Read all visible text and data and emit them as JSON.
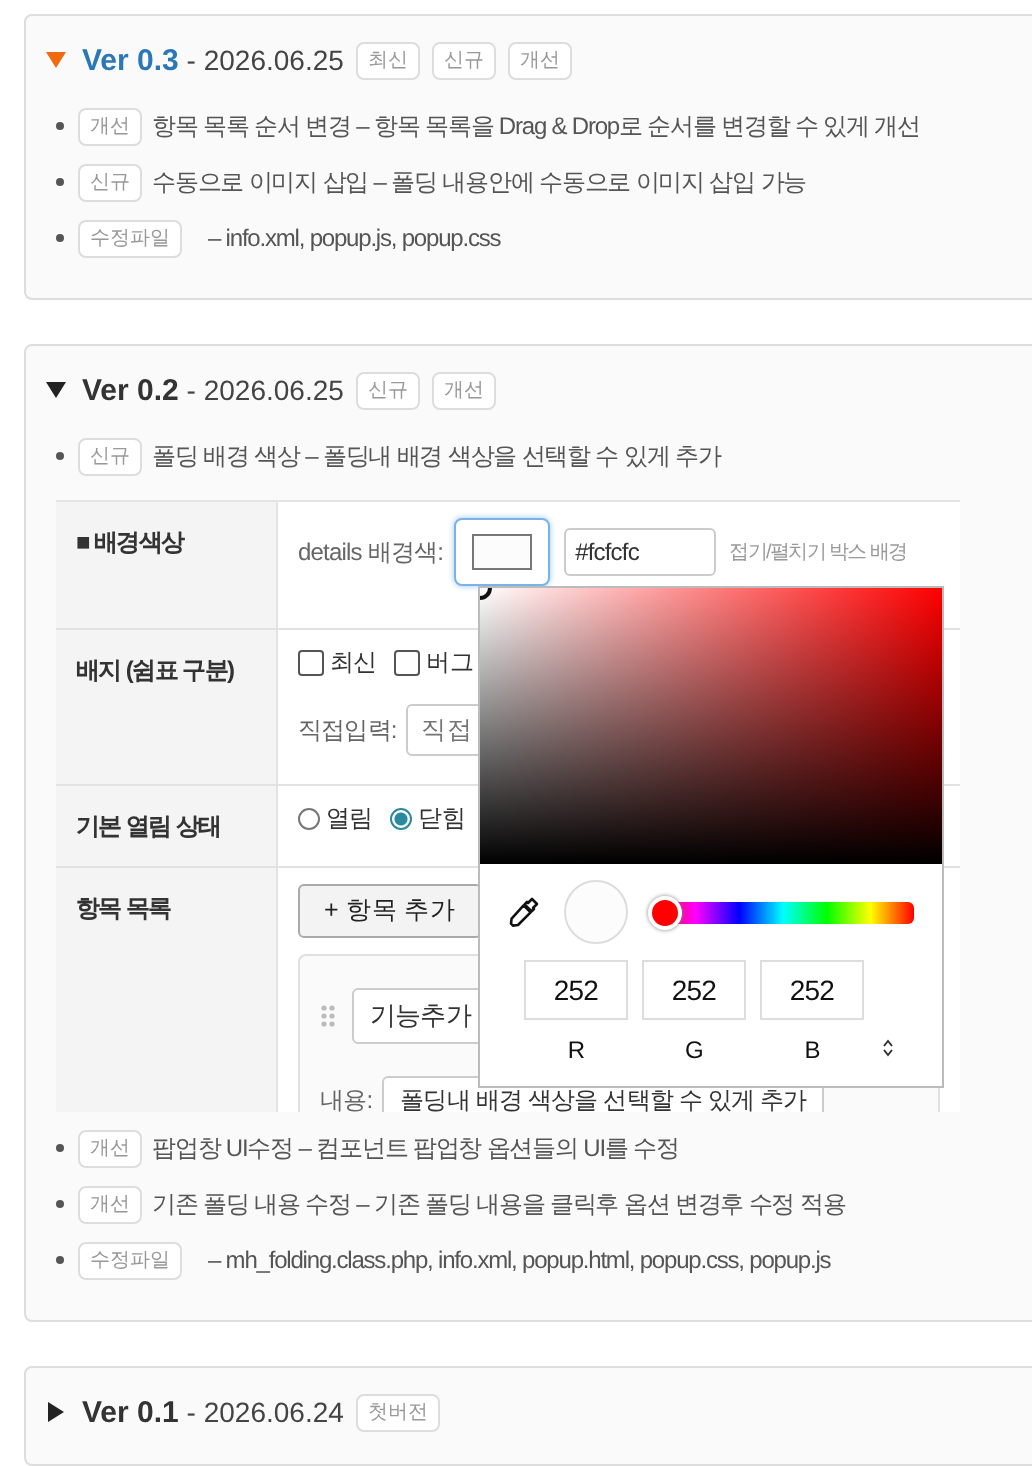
{
  "versions": [
    {
      "title": "**Ver 0.3** - 2026.06.25",
      "expanded": true,
      "current": true,
      "badges": [
        "최신",
        "신규",
        "개선"
      ],
      "items": [
        {
          "kind": "change",
          "badge": "개선",
          "text": "항목 목록 순서 변경 – 항목 목록을 Drag & Drop로 순서를 변경할 수 있게 개선"
        },
        {
          "kind": "change",
          "badge": "신규",
          "text": "수동으로 이미지 삽입 – 폴딩 내용안에 수동으로 이미지 삽입 가능"
        },
        {
          "kind": "files",
          "badge": "수정파일",
          "text": "– info.xml, popup.js, popup.css"
        }
      ]
    },
    {
      "title": "**Ver 0.2** - 2026.06.25",
      "expanded": true,
      "current": false,
      "badges": [
        "신규",
        "개선"
      ],
      "items": [
        {
          "kind": "change",
          "badge": "신규",
          "text": "폴딩 배경 색상 – 폴딩내 배경 색상을 선택할 수 있게 추가"
        },
        {
          "kind": "screenshot",
          "rows": [
            {
              "kind": "color",
              "label": "■ 배경색상",
              "field_label": "details 배경색:",
              "value": "#fcfcfc",
              "hint": "접기/펼치기 박스 배경"
            },
            {
              "kind": "checks",
              "label": "배지 (쉼표 구분)",
              "options": [
                {
                  "label": "최신",
                  "checked": false
                },
                {
                  "label": "버그",
                  "checked": false
                }
              ],
              "input_label": "직접입력:",
              "placeholder": "직접"
            },
            {
              "kind": "radios",
              "label": "기본 열림 상태",
              "options": [
                {
                  "label": "열림",
                  "selected": false
                },
                {
                  "label": "닫힘",
                  "selected": true
                }
              ]
            },
            {
              "kind": "list",
              "label": "항목 목록",
              "button": "+ 항목 추가",
              "select": "기능추가",
              "content_label": "내용:",
              "content": "폴딩내 배경 색상을 선택할 수 있게 추가"
            }
          ],
          "picker": {
            "hue_slider": {
              "level": 0
            },
            "values": [
              "252",
              "252",
              "252"
            ],
            "labels": [
              "R",
              "G",
              "B"
            ]
          }
        },
        {
          "kind": "change",
          "badge": "개선",
          "text": "팝업창 UI수정 – 컴포넌트 팝업창 옵션들의 UI를 수정"
        },
        {
          "kind": "change",
          "badge": "개선",
          "text": "기존 폴딩 내용 수정 – 기존 폴딩 내용을 클릭후 옵션 변경후 수정 적용"
        },
        {
          "kind": "files",
          "badge": "수정파일",
          "text": "– mh_folding.class.php, info.xml, popup.html, popup.css, popup.js"
        }
      ]
    },
    {
      "title": "**Ver 0.1** - 2026.06.24",
      "expanded": false,
      "current": false,
      "badges": [
        "첫버전"
      ]
    }
  ]
}
